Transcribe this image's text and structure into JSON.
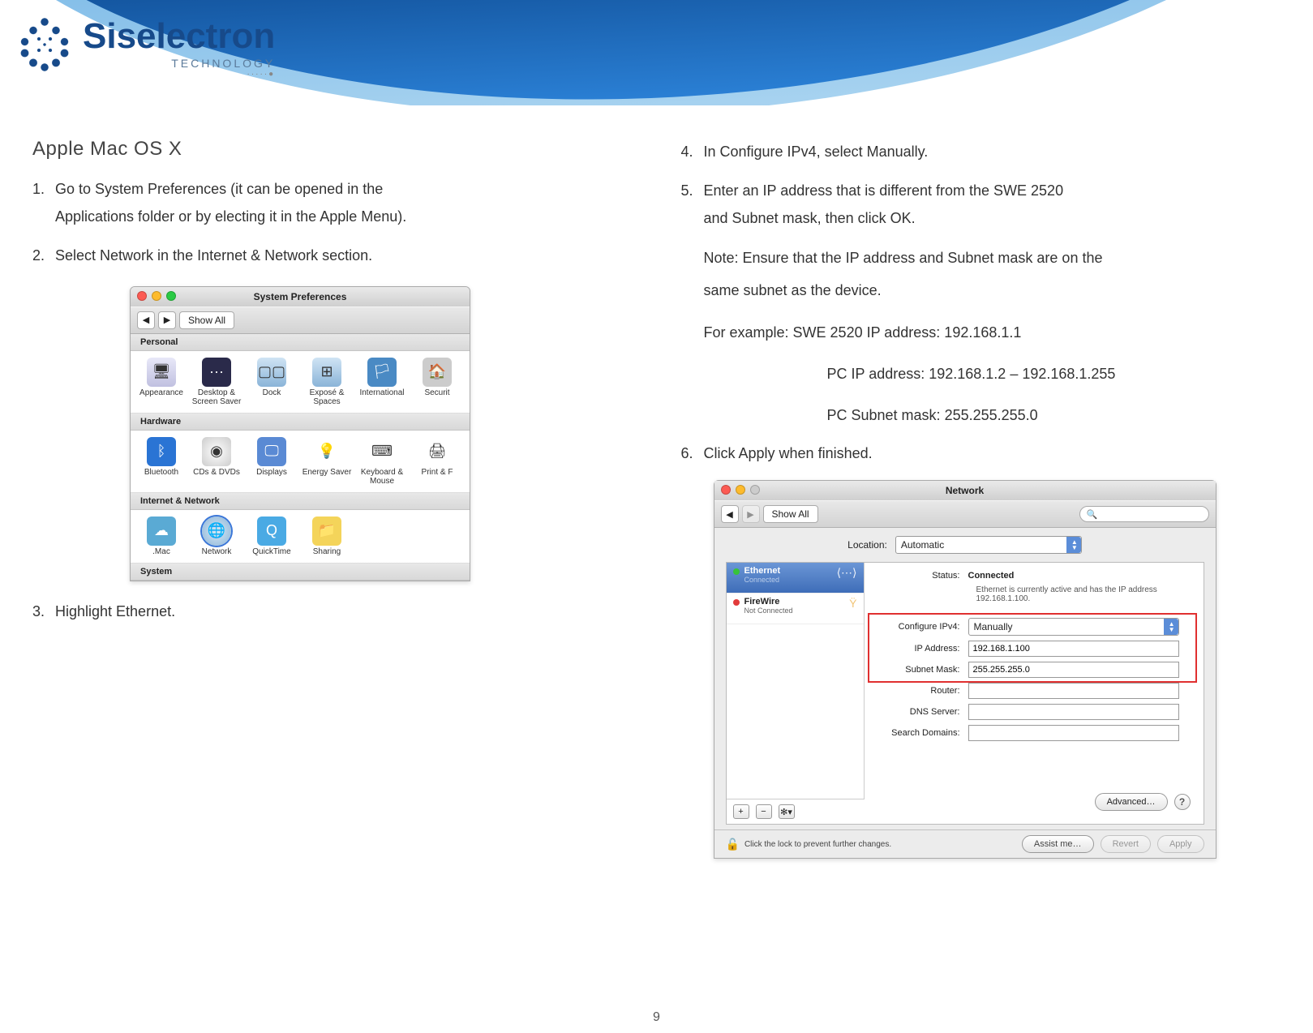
{
  "brand": {
    "name": "Siselectron",
    "sub": "TECHNOLOGY",
    "tag": "·····●"
  },
  "left": {
    "title": "Apple  Mac OS X",
    "s1a": "Go to  System Preferences  (it  can  be  opened in  the",
    "s1b": "Applications  folder  or by electing it in the  Apple Menu).",
    "s2": "Select  Network in the  Internet & Network section.",
    "s3": "Highlight Ethernet."
  },
  "syspref": {
    "title": "System Preferences",
    "showall": "Show All",
    "sec_personal": "Personal",
    "sec_hardware": "Hardware",
    "sec_internet": "Internet & Network",
    "sec_system": "System",
    "personal": [
      "Appearance",
      "Desktop & Screen Saver",
      "Dock",
      "Exposé & Spaces",
      "International",
      "Securit"
    ],
    "hardware": [
      "Bluetooth",
      "CDs & DVDs",
      "Displays",
      "Energy Saver",
      "Keyboard & Mouse",
      "Print & F"
    ],
    "internet": [
      ".Mac",
      "Network",
      "QuickTime",
      "Sharing"
    ]
  },
  "right": {
    "s4": "In Configure IPv4,  select Manually.",
    "s5a": "Enter an IP address that  is different from the  SWE 2520",
    "s5b": "and  Subnet  mask,  then  click OK.",
    "note1": "Note:  Ensure  that the  IP address and  Subnet  mask  are on the",
    "note2": "same  subnet as  the  device.",
    "ex1": "For example:  SWE 2520  IP address: 192.168.1.1",
    "ex2": "PC IP address: 192.168.1.2 – 192.168.1.255",
    "ex3": "PC Subnet  mask: 255.255.255.0",
    "s6": "Click Apply when  finished."
  },
  "net": {
    "title": "Network",
    "showall": "Show All",
    "location_label": "Location:",
    "location_value": "Automatic",
    "svc1_name": "Ethernet",
    "svc1_stat": "Connected",
    "svc2_name": "FireWire",
    "svc2_stat": "Not Connected",
    "status_label": "Status:",
    "status_value": "Connected",
    "status_sub": "Ethernet is currently active and has the IP address 192.168.1.100.",
    "cfg_label": "Configure IPv4:",
    "cfg_value": "Manually",
    "ip_label": "IP Address:",
    "ip_value": "192.168.1.100",
    "mask_label": "Subnet Mask:",
    "mask_value": "255.255.255.0",
    "router_label": "Router:",
    "dns_label": "DNS Server:",
    "search_label": "Search Domains:",
    "advanced": "Advanced…",
    "lock_text": "Click the lock to prevent further changes.",
    "assist": "Assist me…",
    "revert": "Revert",
    "apply": "Apply"
  },
  "page": "9"
}
